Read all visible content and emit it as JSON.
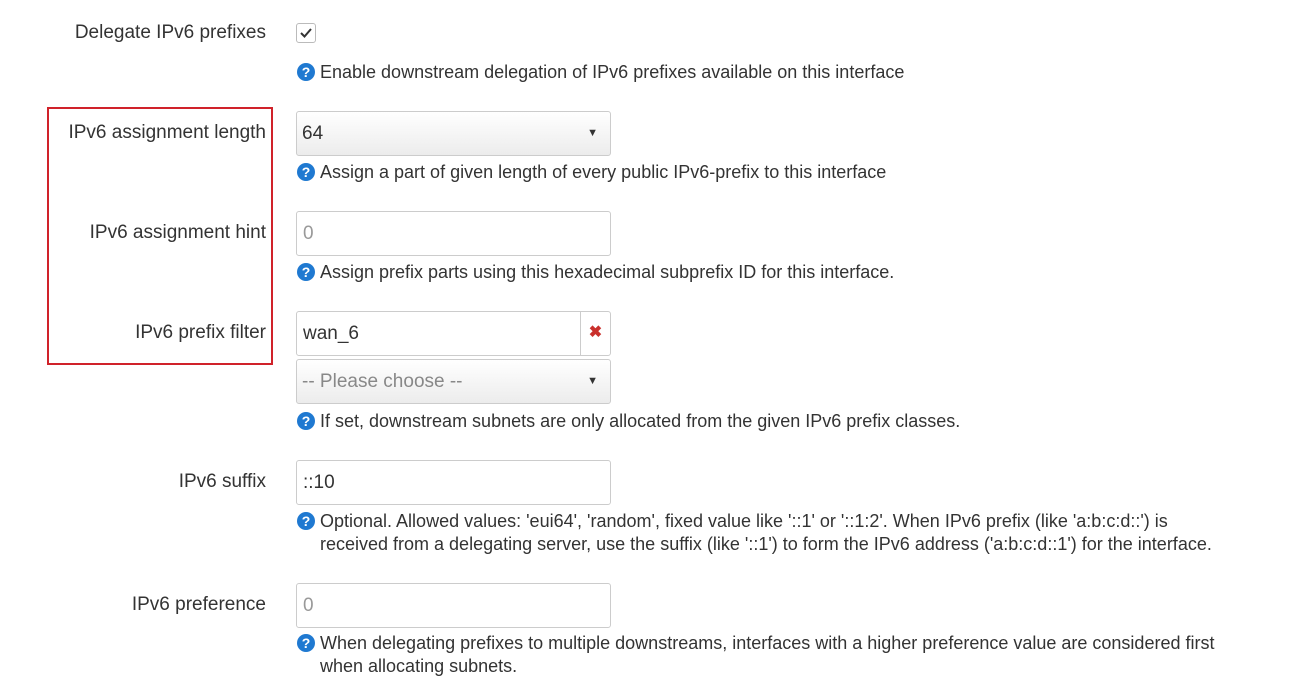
{
  "fields": {
    "delegate": {
      "label": "Delegate IPv6 prefixes",
      "checked": true,
      "help": "Enable downstream delegation of IPv6 prefixes available on this interface"
    },
    "assignment_length": {
      "label": "IPv6 assignment length",
      "value": "64",
      "help": "Assign a part of given length of every public IPv6-prefix to this interface"
    },
    "assignment_hint": {
      "label": "IPv6 assignment hint",
      "placeholder": "0",
      "help": "Assign prefix parts using this hexadecimal subprefix ID for this interface."
    },
    "prefix_filter": {
      "label": "IPv6 prefix filter",
      "value": "wan_6",
      "clear_symbol": "✖",
      "choose_placeholder": "-- Please choose --",
      "help": "If set, downstream subnets are only allocated from the given IPv6 prefix classes."
    },
    "suffix": {
      "label": "IPv6 suffix",
      "value": "::10",
      "help_line1": "Optional. Allowed values: 'eui64', 'random', fixed value like '::1' or '::1:2'. When IPv6 prefix (like 'a:b:c:d::') is",
      "help_line2": "received from a delegating server, use the suffix (like '::1') to form the IPv6 address ('a:b:c:d::1') for the interface."
    },
    "preference": {
      "label": "IPv6 preference",
      "placeholder": "0",
      "help_line1": "When delegating prefixes to multiple downstreams, interfaces with a higher preference value are considered first",
      "help_line2": "when allocating subnets."
    }
  },
  "icons": {
    "help": "question-circle-icon",
    "caret": "caret-down-icon",
    "check": "checkmark-icon",
    "clear": "close-icon"
  },
  "colors": {
    "help_icon": "#1f79d1",
    "highlight_border": "#d0222a",
    "clear_icon": "#c9302c"
  }
}
